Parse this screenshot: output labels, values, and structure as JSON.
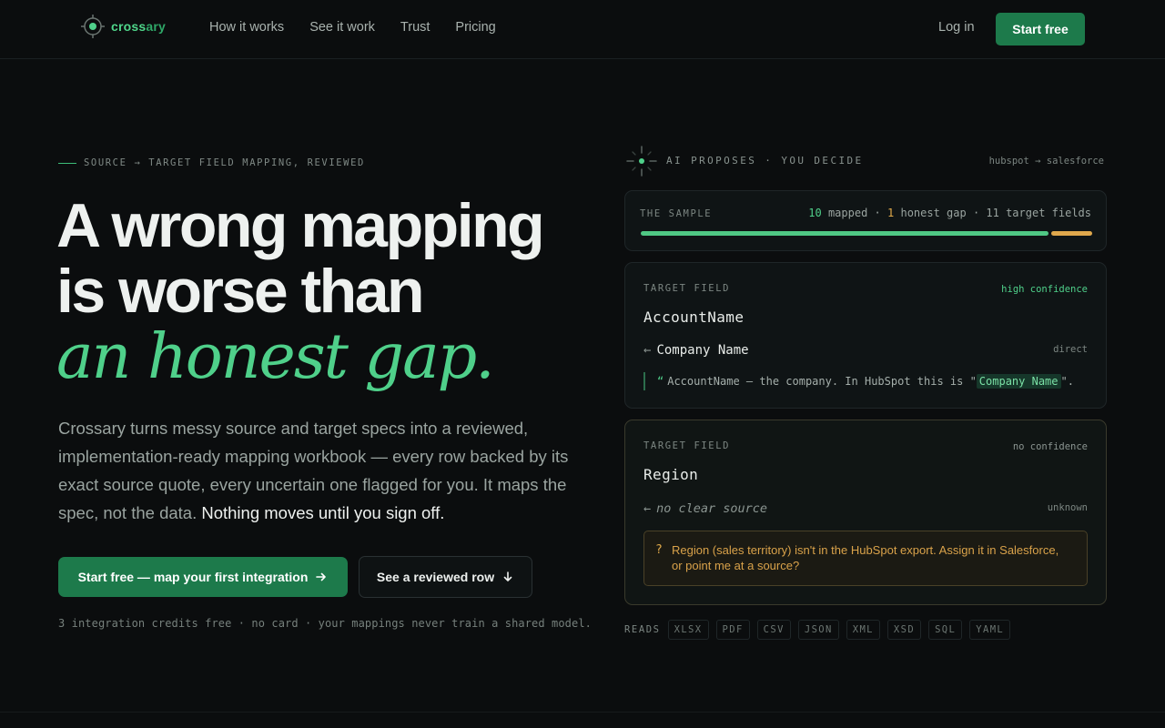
{
  "brand": {
    "name_part1": "cross",
    "name_part2": "ary",
    "accent": "#4fd08a",
    "cta_bg": "#1d7a4b"
  },
  "nav": {
    "links": [
      "How it works",
      "See it work",
      "Trust",
      "Pricing"
    ],
    "login": "Log in",
    "cta": "Start free"
  },
  "hero": {
    "eyebrow": "SOURCE → TARGET FIELD MAPPING, REVIEWED",
    "headline_line1": "A wrong mapping",
    "headline_line2": "is worse than",
    "headline_accent": "an honest gap.",
    "lead": "Crossary turns messy source and target specs into a reviewed, implementation-ready mapping workbook — every row backed by its exact source quote, every uncertain one flagged for you. It maps the spec, not the data.",
    "lead_strong": "Nothing moves until you sign off.",
    "primary_cta": "Start free — map your first integration",
    "secondary_cta": "See a reviewed row",
    "fineprint": "3 integration credits free · no card · your mappings never train a shared model."
  },
  "panel": {
    "label": "AI PROPOSES · YOU DECIDE",
    "route": "hubspot → salesforce",
    "sample": {
      "title": "THE SAMPLE",
      "mapped_count": "10",
      "mapped_label": "mapped",
      "gap_count": "1",
      "gap_label": "honest gap",
      "target_label": "11 target fields",
      "mapped_fraction": 0.909
    },
    "field1": {
      "label": "TARGET FIELD",
      "confidence": "high confidence",
      "name": "AccountName",
      "source": "Company Name",
      "kind": "direct",
      "quote_prefix": "AccountName — the company. In HubSpot this is \"",
      "quote_chip": "Company Name",
      "quote_suffix": "\"."
    },
    "field2": {
      "label": "TARGET FIELD",
      "confidence": "no confidence",
      "name": "Region",
      "source": "no clear source",
      "kind": "unknown",
      "warning": "Region (sales territory) isn't in the HubSpot export. Assign it in Salesforce, or point me at a source?"
    },
    "reads_label": "READS",
    "formats": [
      "XLSX",
      "PDF",
      "CSV",
      "JSON",
      "XML",
      "XSD",
      "SQL",
      "YAML"
    ]
  }
}
